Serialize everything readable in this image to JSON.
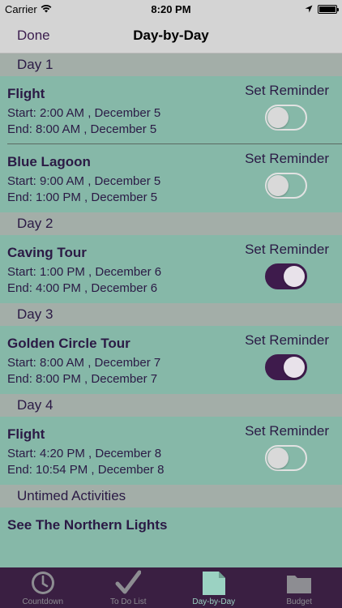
{
  "status_bar": {
    "carrier": "Carrier",
    "time": "8:20 PM"
  },
  "nav": {
    "back_label": "Done",
    "title": "Day-by-Day"
  },
  "reminder_label": "Set Reminder",
  "sections": [
    {
      "title": "Day 1",
      "items": [
        {
          "title": "Flight",
          "start": "Start: 2:00 AM , December 5",
          "end": "End: 8:00 AM , December 5",
          "reminder": false
        },
        {
          "title": "Blue Lagoon",
          "start": "Start: 9:00 AM , December 5",
          "end": "End: 1:00 PM , December 5",
          "reminder": false
        }
      ]
    },
    {
      "title": "Day 2",
      "items": [
        {
          "title": "Caving Tour",
          "start": "Start: 1:00 PM , December 6",
          "end": "End: 4:00 PM , December 6",
          "reminder": true
        }
      ]
    },
    {
      "title": "Day 3",
      "items": [
        {
          "title": "Golden Circle Tour",
          "start": "Start: 8:00 AM , December 7",
          "end": "End: 8:00 PM , December 7",
          "reminder": true
        }
      ]
    },
    {
      "title": "Day 4",
      "items": [
        {
          "title": "Flight",
          "start": "Start: 4:20 PM , December 8",
          "end": "End: 10:54 PM , December 8",
          "reminder": false
        }
      ]
    },
    {
      "title": "Untimed Activities",
      "items": [
        {
          "title": "See The Northern Lights"
        }
      ]
    }
  ],
  "tabs": [
    {
      "label": "Countdown",
      "icon": "clock-icon",
      "active": false
    },
    {
      "label": "To Do List",
      "icon": "checkmark-icon",
      "active": false
    },
    {
      "label": "Day-by-Day",
      "icon": "document-icon",
      "active": true
    },
    {
      "label": "Budget",
      "icon": "folder-icon",
      "active": false
    }
  ],
  "colors": {
    "background": "#86b8a8",
    "section_header": "#a3aea8",
    "text": "#2b1a45",
    "toggle_on": "#3e1b4c",
    "tab_bar": "#3a1f42",
    "tab_active": "#9bd2c2"
  }
}
